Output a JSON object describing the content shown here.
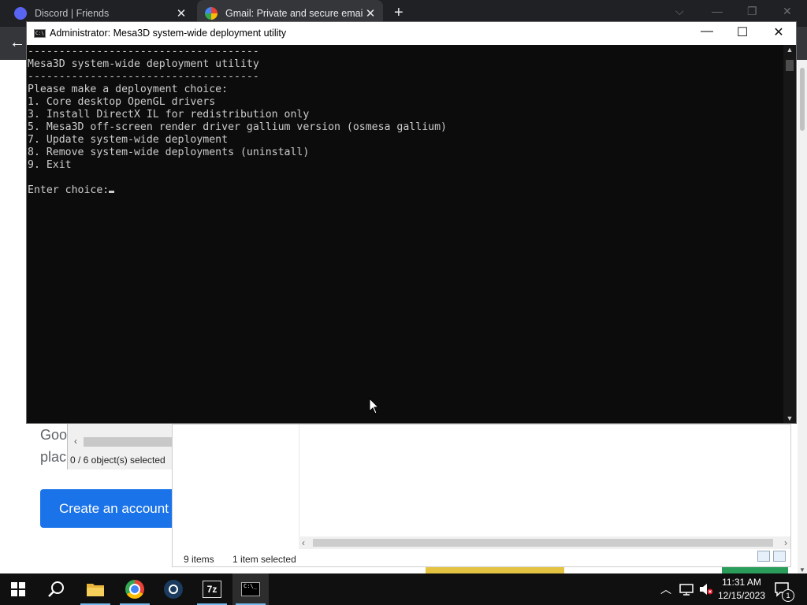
{
  "browser": {
    "tabs": [
      {
        "title": "Discord | Friends",
        "active": false,
        "icon": "discord-icon",
        "icon_color": "#5865f2"
      },
      {
        "title": "Gmail: Private and secure email a",
        "active": true,
        "icon": "google-icon",
        "icon_color": "#ffffff"
      }
    ],
    "tab_close": "✕",
    "new_tab": "+",
    "back": "←"
  },
  "gmail_page": {
    "text_line1": "Goo",
    "text_line2": "plac",
    "create_account": "Create an account"
  },
  "zip_window": {
    "status": "0 / 6 object(s) selected"
  },
  "explorer": {
    "items_count": "9 items",
    "selection": "1 item selected"
  },
  "console": {
    "title": "Administrator:  Mesa3D system-wide deployment utility",
    "icon_text": "C:\\",
    "minimize": "—",
    "maximize": "☐",
    "close": "✕",
    "lines": [
      "-------------------------------------",
      "Mesa3D system-wide deployment utility",
      "-------------------------------------",
      "Please make a deployment choice:",
      "1. Core desktop OpenGL drivers",
      "3. Install DirectX IL for redistribution only",
      "5. Mesa3D off-screen render driver gallium version (osmesa gallium)",
      "7. Update system-wide deployment",
      "8. Remove system-wide deployments (uninstall)",
      "9. Exit",
      "",
      "Enter choice:"
    ]
  },
  "taskbar": {
    "apps": [
      {
        "name": "start-button",
        "icon": "windows-icon"
      },
      {
        "name": "search-button",
        "icon": "search-icon"
      },
      {
        "name": "file-explorer",
        "icon": "folder-icon"
      },
      {
        "name": "chrome",
        "icon": "chrome-icon"
      },
      {
        "name": "steam",
        "icon": "steam-icon"
      },
      {
        "name": "7zip",
        "icon": "7zip-icon",
        "label": "7z"
      },
      {
        "name": "terminal",
        "icon": "terminal-icon"
      }
    ],
    "time": "11:31 AM",
    "date": "12/15/2023",
    "notification_count": "1"
  },
  "colors": {
    "console_bg": "#0c0c0c",
    "console_text": "#cccccc",
    "accent": "#1a73e8",
    "taskbar": "#101010"
  }
}
